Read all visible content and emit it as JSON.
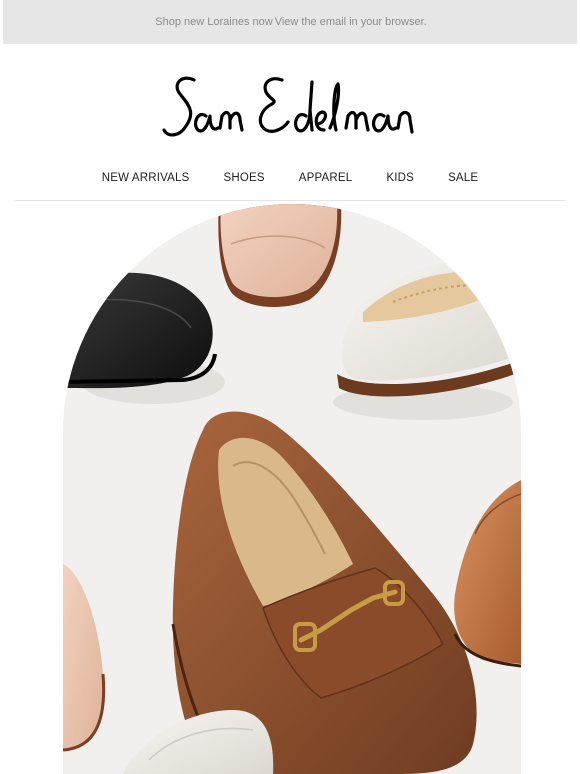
{
  "preheader": {
    "shop_text": "Shop new Loraines now",
    "browser_link": "View the email in your browser."
  },
  "brand": {
    "logo_text": "Sam Edelman"
  },
  "nav": {
    "items": [
      {
        "label": "NEW ARRIVALS"
      },
      {
        "label": "SHOES"
      },
      {
        "label": "APPAREL"
      },
      {
        "label": "KIDS"
      },
      {
        "label": "SALE"
      }
    ]
  },
  "hero": {
    "shoe_colors": {
      "blush": "#e9c3ac",
      "black": "#1b1b1b",
      "ivory": "#eeebe5",
      "cognac": "#8e5230",
      "tan": "#c47a44",
      "gold_bit": "#c89b45",
      "background": "#f1f0ee"
    }
  }
}
